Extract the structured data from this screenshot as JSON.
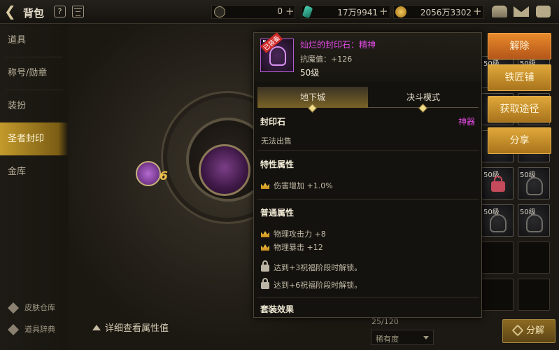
{
  "topbar": {
    "title": "背包",
    "help": "?",
    "currencies": [
      {
        "name": "coin",
        "icon": "coin-c-icon",
        "value": "0"
      },
      {
        "name": "gem",
        "icon": "green-crystal-icon",
        "value": "17万9941"
      },
      {
        "name": "gold",
        "icon": "gold-coin-icon",
        "value": "2056万3302"
      }
    ],
    "plus": "+"
  },
  "sidebar": {
    "items": [
      {
        "label": "道具"
      },
      {
        "label": "称号/勋章"
      },
      {
        "label": "装扮"
      },
      {
        "label": "圣者封印"
      },
      {
        "label": "金库"
      }
    ],
    "active_index": 3,
    "bottom": [
      {
        "label": "皮肤仓库",
        "icon": "skin-warehouse-icon"
      },
      {
        "label": "道具辞典",
        "icon": "item-dictionary-icon"
      }
    ]
  },
  "stage": {
    "level_badge": "6",
    "detail_link": "详细查看属性值"
  },
  "tooltip": {
    "item_name": "灿烂的封印石：精神",
    "stat": "抗魔值：+126",
    "level": "50级",
    "icon_level": "50",
    "icon_tag": "已装备",
    "tabs": [
      {
        "label": "地下城",
        "active": true
      },
      {
        "label": "决斗模式",
        "active": false
      }
    ],
    "type_label": "封印石",
    "rarity_label": "神器",
    "trade_note": "无法出售",
    "special_title": "特性属性",
    "special_attrs": [
      "伤害增加 +1.0%"
    ],
    "normal_title": "普通属性",
    "normal_attrs": [
      "物理攻击力 +8",
      "物理暴击 +12"
    ],
    "locked_attrs": [
      "达到+3祝福阶段时解锁。",
      "达到+6祝福阶段时解锁。"
    ],
    "set_title": "套装效果"
  },
  "actions": {
    "unequip": "解除",
    "blacksmith": "铁匠铺",
    "source": "获取途径",
    "share": "分享"
  },
  "grid": {
    "cell_level": "50级",
    "capacity": "25/120",
    "sort_label": "稀有度",
    "decompose": "分解"
  },
  "colors": {
    "accent_gold": "#c29a2c",
    "rarity_purple": "#e54be8",
    "action_orange": "#e88a2a"
  }
}
